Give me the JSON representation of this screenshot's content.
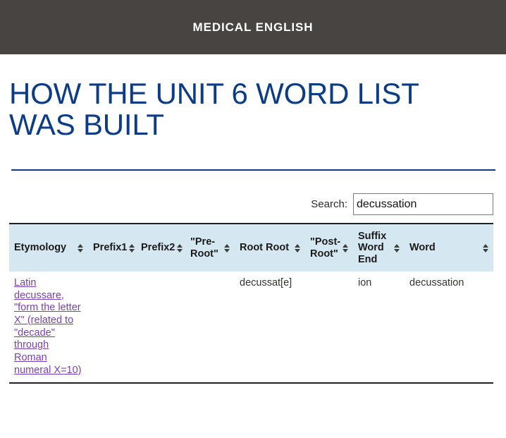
{
  "site": {
    "header_title": "MEDICAL ENGLISH",
    "header_bg": "#474442",
    "accent_color": "#0d3c86",
    "table_header_bg": "#d5e8f2",
    "link_color": "#7b3fb5"
  },
  "page": {
    "title": "How the Unit 6 Word List Was Built"
  },
  "search": {
    "label": "Search:",
    "value": "decussation",
    "placeholder": ""
  },
  "table": {
    "columns": [
      {
        "label": "Etymology",
        "sort_icon": "sort-updown-icon"
      },
      {
        "label": "Prefix1",
        "sort_icon": "sort-updown-icon"
      },
      {
        "label": "Prefix2",
        "sort_icon": "sort-updown-icon"
      },
      {
        "label": "\"Pre-Root\"",
        "sort_icon": "sort-updown-icon"
      },
      {
        "label": "Root Root",
        "sort_icon": "sort-updown-icon"
      },
      {
        "label": "\"Post-Root\"",
        "sort_icon": "sort-updown-icon"
      },
      {
        "label": "Suffix Word End",
        "sort_icon": "sort-updown-icon"
      },
      {
        "label": "Word",
        "sort_icon": "sort-updown-icon"
      }
    ],
    "rows": [
      {
        "etymology": "Latin decussare, \"form the letter X\" (related to \"decade\" through Roman numeral X=10)",
        "prefix1": "",
        "prefix2": "",
        "pre_root": "",
        "root_root": "decussat[e]",
        "post_root": "",
        "suffix_word_end": "ion",
        "word": "decussation"
      }
    ]
  }
}
